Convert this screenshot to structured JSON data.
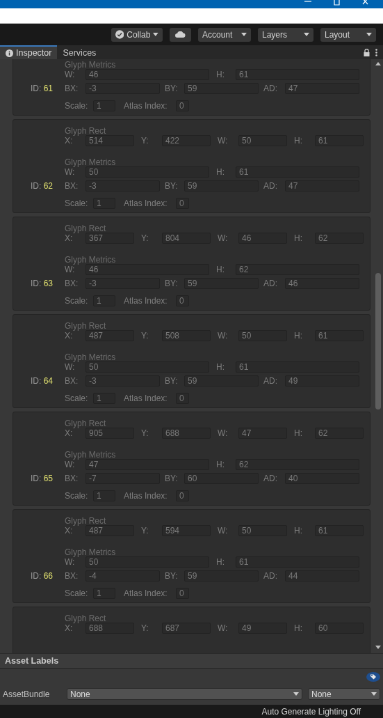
{
  "toolbar": {
    "buttons": [
      {
        "kind": "check",
        "label": "Collab"
      },
      {
        "kind": "cloud"
      },
      {
        "kind": "menu",
        "label": "Account"
      },
      {
        "kind": "menu",
        "label": "Layers"
      },
      {
        "kind": "menu",
        "label": "Layout"
      }
    ]
  },
  "tabs": [
    {
      "label": "Inspector",
      "selected": true
    },
    {
      "label": "Services",
      "selected": false
    }
  ],
  "glyphs": [
    {
      "id_label": "ID:",
      "id": "61",
      "metrics": {
        "title": "Glyph Metrics",
        "rows": [
          [
            {
              "label": "W:",
              "value": "46"
            },
            {
              "label": "H:",
              "value": "61"
            }
          ],
          [
            {
              "label": "BX:",
              "value": "-3"
            },
            {
              "label": "BY:",
              "value": "59"
            },
            {
              "label": "AD:",
              "value": "47"
            }
          ]
        ]
      },
      "scale": {
        "label": "Scale:",
        "value": "1"
      },
      "atlas": {
        "label": "Atlas Index:",
        "value": "0"
      }
    },
    {
      "id_label": "ID:",
      "id": "62",
      "rect": {
        "title": "Glyph Rect",
        "fields": [
          {
            "label": "X:",
            "value": "514"
          },
          {
            "label": "Y:",
            "value": "422"
          },
          {
            "label": "W:",
            "value": "50"
          },
          {
            "label": "H:",
            "value": "61"
          }
        ]
      },
      "metrics": {
        "title": "Glyph Metrics",
        "rows": [
          [
            {
              "label": "W:",
              "value": "50"
            },
            {
              "label": "H:",
              "value": "61"
            }
          ],
          [
            {
              "label": "BX:",
              "value": "-3"
            },
            {
              "label": "BY:",
              "value": "59"
            },
            {
              "label": "AD:",
              "value": "47"
            }
          ]
        ]
      },
      "scale": {
        "label": "Scale:",
        "value": "1"
      },
      "atlas": {
        "label": "Atlas Index:",
        "value": "0"
      }
    },
    {
      "id_label": "ID:",
      "id": "63",
      "rect": {
        "title": "Glyph Rect",
        "fields": [
          {
            "label": "X:",
            "value": "367"
          },
          {
            "label": "Y:",
            "value": "804"
          },
          {
            "label": "W:",
            "value": "46"
          },
          {
            "label": "H:",
            "value": "62"
          }
        ]
      },
      "metrics": {
        "title": "Glyph Metrics",
        "rows": [
          [
            {
              "label": "W:",
              "value": "46"
            },
            {
              "label": "H:",
              "value": "62"
            }
          ],
          [
            {
              "label": "BX:",
              "value": "-3"
            },
            {
              "label": "BY:",
              "value": "59"
            },
            {
              "label": "AD:",
              "value": "46"
            }
          ]
        ]
      },
      "scale": {
        "label": "Scale:",
        "value": "1"
      },
      "atlas": {
        "label": "Atlas Index:",
        "value": "0"
      }
    },
    {
      "id_label": "ID:",
      "id": "64",
      "rect": {
        "title": "Glyph Rect",
        "fields": [
          {
            "label": "X:",
            "value": "487"
          },
          {
            "label": "Y:",
            "value": "508"
          },
          {
            "label": "W:",
            "value": "50"
          },
          {
            "label": "H:",
            "value": "61"
          }
        ]
      },
      "metrics": {
        "title": "Glyph Metrics",
        "rows": [
          [
            {
              "label": "W:",
              "value": "50"
            },
            {
              "label": "H:",
              "value": "61"
            }
          ],
          [
            {
              "label": "BX:",
              "value": "-3"
            },
            {
              "label": "BY:",
              "value": "59"
            },
            {
              "label": "AD:",
              "value": "49"
            }
          ]
        ]
      },
      "scale": {
        "label": "Scale:",
        "value": "1"
      },
      "atlas": {
        "label": "Atlas Index:",
        "value": "0"
      }
    },
    {
      "id_label": "ID:",
      "id": "65",
      "rect": {
        "title": "Glyph Rect",
        "fields": [
          {
            "label": "X:",
            "value": "905"
          },
          {
            "label": "Y:",
            "value": "688"
          },
          {
            "label": "W:",
            "value": "47"
          },
          {
            "label": "H:",
            "value": "62"
          }
        ]
      },
      "metrics": {
        "title": "Glyph Metrics",
        "rows": [
          [
            {
              "label": "W:",
              "value": "47"
            },
            {
              "label": "H:",
              "value": "62"
            }
          ],
          [
            {
              "label": "BX:",
              "value": "-7"
            },
            {
              "label": "BY:",
              "value": "60"
            },
            {
              "label": "AD:",
              "value": "40"
            }
          ]
        ]
      },
      "scale": {
        "label": "Scale:",
        "value": "1"
      },
      "atlas": {
        "label": "Atlas Index:",
        "value": "0"
      }
    },
    {
      "id_label": "ID:",
      "id": "66",
      "rect": {
        "title": "Glyph Rect",
        "fields": [
          {
            "label": "X:",
            "value": "487"
          },
          {
            "label": "Y:",
            "value": "594"
          },
          {
            "label": "W:",
            "value": "50"
          },
          {
            "label": "H:",
            "value": "61"
          }
        ]
      },
      "metrics": {
        "title": "Glyph Metrics",
        "rows": [
          [
            {
              "label": "W:",
              "value": "50"
            },
            {
              "label": "H:",
              "value": "61"
            }
          ],
          [
            {
              "label": "BX:",
              "value": "-4"
            },
            {
              "label": "BY:",
              "value": "59"
            },
            {
              "label": "AD:",
              "value": "44"
            }
          ]
        ]
      },
      "scale": {
        "label": "Scale:",
        "value": "1"
      },
      "atlas": {
        "label": "Atlas Index:",
        "value": "0"
      }
    },
    {
      "rect": {
        "title": "Glyph Rect",
        "fields": [
          {
            "label": "X:",
            "value": "688"
          },
          {
            "label": "Y:",
            "value": "687"
          },
          {
            "label": "W:",
            "value": "49"
          },
          {
            "label": "H:",
            "value": "60"
          }
        ]
      }
    }
  ],
  "asset_labels": {
    "title": "Asset Labels",
    "bundle_label": "AssetBundle",
    "bundle": "None",
    "variant": "None"
  },
  "status_bar": {
    "text": "Auto Generate Lighting Off"
  }
}
